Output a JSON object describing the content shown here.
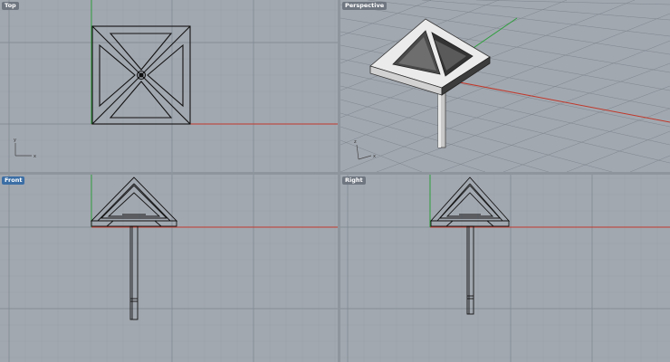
{
  "viewports": {
    "top": {
      "label": "Top",
      "active": false
    },
    "perspective": {
      "label": "Perspective",
      "active": false
    },
    "front": {
      "label": "Front",
      "active": true
    },
    "right": {
      "label": "Right",
      "active": false
    }
  },
  "axis_indicator": {
    "x_label": "x",
    "y_label": "y",
    "z_label": "z"
  },
  "colors": {
    "viewport_bg": "#a2a8b0",
    "grid_minor": "#98a0a8",
    "grid_major": "#7e868f",
    "axis_x": "#c0392b",
    "axis_y": "#2e9e3e",
    "wire": "#111111",
    "active_label": "#3b6ea5"
  }
}
